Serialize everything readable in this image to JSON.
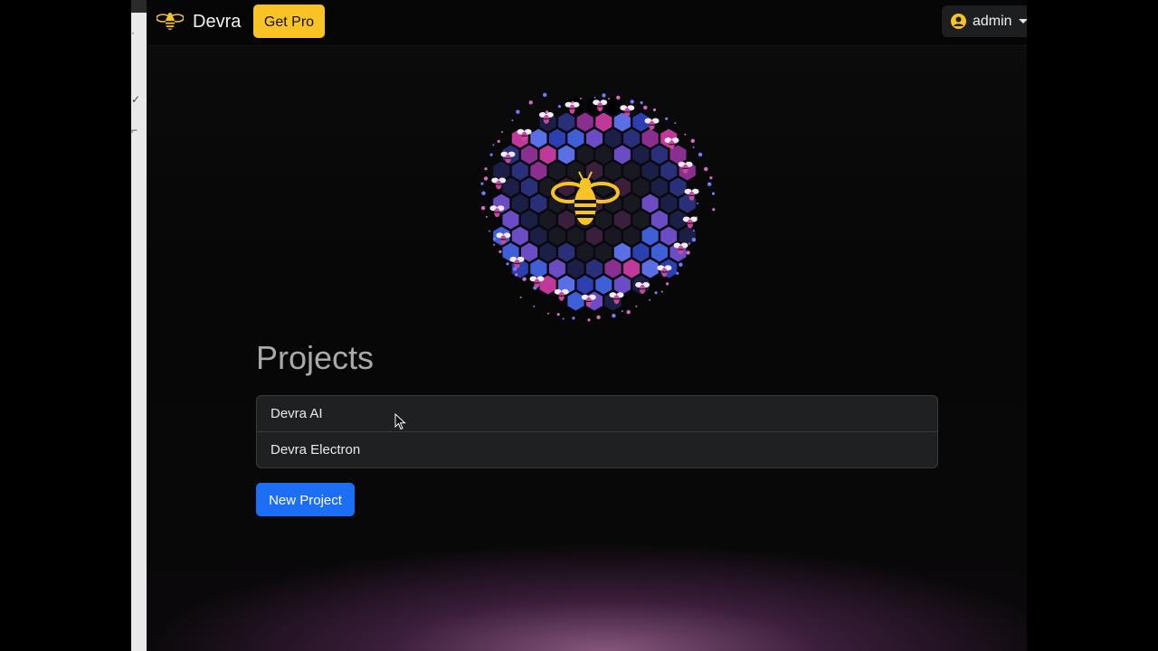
{
  "navbar": {
    "brand": "Devra",
    "get_pro_label": "Get Pro",
    "user": {
      "name": "admin",
      "icon": "user-circle-icon"
    }
  },
  "main": {
    "title": "Projects",
    "projects": [
      {
        "name": "Devra AI"
      },
      {
        "name": "Devra Electron"
      }
    ],
    "new_project_label": "New Project"
  },
  "colors": {
    "accent_yellow": "#f7c325",
    "primary_blue": "#1c6ef5",
    "list_bg": "#1f2022"
  },
  "icons": {
    "brand": "bee-icon",
    "hero": "bee-hive-illustration"
  }
}
